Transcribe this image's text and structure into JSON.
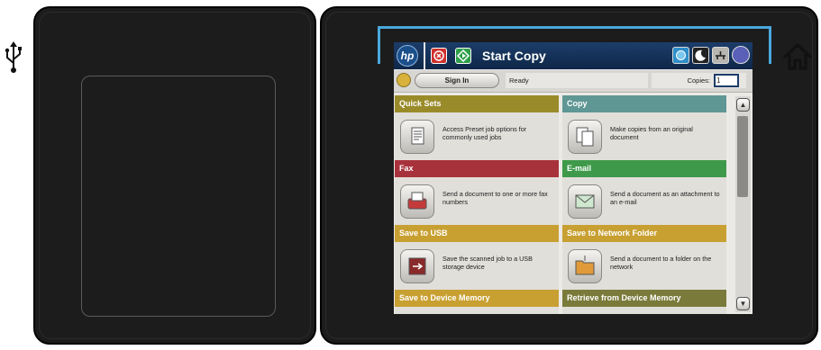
{
  "device": {
    "usb_icon": "usb-icon",
    "home_icon": "home-icon"
  },
  "titlebar": {
    "logo": "hp",
    "title": "Start Copy",
    "stop_icon": "stop-icon",
    "start_icon": "start-icon",
    "status_icons": [
      "network-icon",
      "sleep-icon",
      "wired-network-icon",
      "help-icon"
    ]
  },
  "statusbar": {
    "sign_in_label": "Sign In",
    "status_text": "Ready",
    "copies_label": "Copies:",
    "copies_value": "1"
  },
  "tiles": [
    {
      "title": "Quick Sets",
      "description": "Access Preset job options for commonly used jobs",
      "color": "#9a8b2a",
      "icon": "quick-sets-icon"
    },
    {
      "title": "Copy",
      "description": "Make copies from an original document",
      "color": "#5f9794",
      "icon": "copy-icon"
    },
    {
      "title": "Fax",
      "description": "Send a document to one or more fax numbers",
      "color": "#a8323c",
      "icon": "fax-icon"
    },
    {
      "title": "E-mail",
      "description": "Send a document as an attachment to an e-mail",
      "color": "#3e9a4a",
      "icon": "email-icon"
    },
    {
      "title": "Save to USB",
      "description": "Save the scanned job to a USB storage device",
      "color": "#c8a032",
      "icon": "save-usb-icon"
    },
    {
      "title": "Save to Network Folder",
      "description": "Send a document to a folder on the network",
      "color": "#c8a032",
      "icon": "network-folder-icon"
    },
    {
      "title": "Save to Device Memory",
      "description": "",
      "color": "#c8a032",
      "icon": ""
    },
    {
      "title": "Retrieve from Device Memory",
      "description": "",
      "color": "#7a7a3a",
      "icon": ""
    }
  ],
  "colors": {
    "bracket": "#4aa8dc",
    "titlebar": "#1c3d6a"
  }
}
